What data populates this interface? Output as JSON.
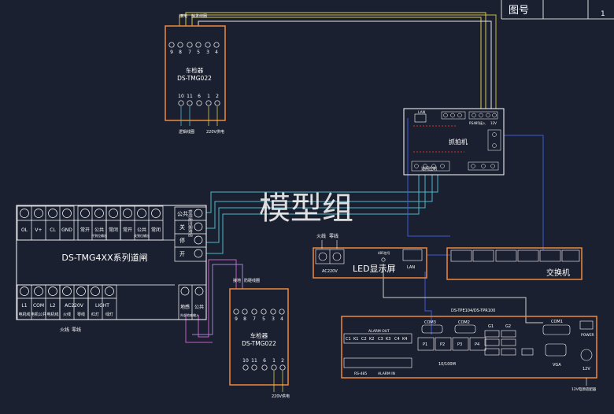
{
  "title_block": {
    "label": "图号",
    "value": "1"
  },
  "watermark": "模型组",
  "detector_top": {
    "top_labels": [
      "接地",
      "触发线圈"
    ],
    "pins_top": [
      "9",
      "8",
      "7",
      "5",
      "3",
      "4"
    ],
    "name": "车检器",
    "model": "DS-TMG022",
    "pins_bottom": [
      "10",
      "11",
      "6",
      "1",
      "2"
    ],
    "bottom_labels": [
      "逻辑线圈",
      "220V供电"
    ]
  },
  "detector_bottom": {
    "top_labels": [
      "接地",
      "防砸线圈"
    ],
    "pins_top": [
      "9",
      "8",
      "7",
      "5",
      "3",
      "4"
    ],
    "name": "车检器",
    "model": "DS-TMG022",
    "pins_bottom": [
      "10",
      "11",
      "6",
      "1",
      "2"
    ],
    "bottom_labels": [
      "220V供电"
    ]
  },
  "camera": {
    "top_labels": [
      "LAN",
      "RS485接入",
      "12V"
    ],
    "title": "抓拍机",
    "bottom_labels": [
      "道闸控制"
    ]
  },
  "barrier": {
    "top_terminals": [
      "OL",
      "V+",
      "CL",
      "GND",
      "常开",
      "公共",
      "常闭",
      "常开",
      "公共",
      "常闭"
    ],
    "top_sub": [
      "开到位输出",
      "关到位输出"
    ],
    "side_labels": [
      "公共",
      "关",
      "停",
      "开"
    ],
    "side_note": "有线遥控器按钮",
    "name": "DS-TMG4XX系列道闸",
    "bottom_terminals": [
      "L1",
      "COM",
      "L2",
      "AC220V",
      "LIGHT"
    ],
    "bottom_sub": [
      "电机线",
      "电机公共",
      "电机线",
      "火线",
      "零线",
      "红灯",
      "绿灯"
    ],
    "power_labels": [
      "火线",
      "零线"
    ],
    "aux_terminals": [
      "地感",
      "公共"
    ],
    "aux_note": "外部地感输入"
  },
  "led": {
    "power_labels": [
      "火线",
      "零线"
    ],
    "power_terminal": "AC220V",
    "signal": "485信号",
    "label": "LED显示屏",
    "lan": "LAN"
  },
  "switch": {
    "label": "交换机"
  },
  "controller": {
    "model": "DS-TPE104/DS-TPR100",
    "alarm_out": "ALARM OUT",
    "alarm_terms": [
      "C1",
      "K1",
      "C2",
      "K2",
      "C3",
      "K3",
      "C4",
      "K4"
    ],
    "com3": "COM3",
    "com2": "COM2",
    "g_ports": [
      "G1",
      "G2"
    ],
    "com1": "COM1",
    "power": "POWER",
    "lan_ports": [
      "P1",
      "P2",
      "P3",
      "P4"
    ],
    "rs485": "RS-485",
    "alarm_in": "ALARM IN",
    "net": "10/100M",
    "vga": "VGA",
    "v12": "12V",
    "adapter": "12V电源适配器"
  }
}
